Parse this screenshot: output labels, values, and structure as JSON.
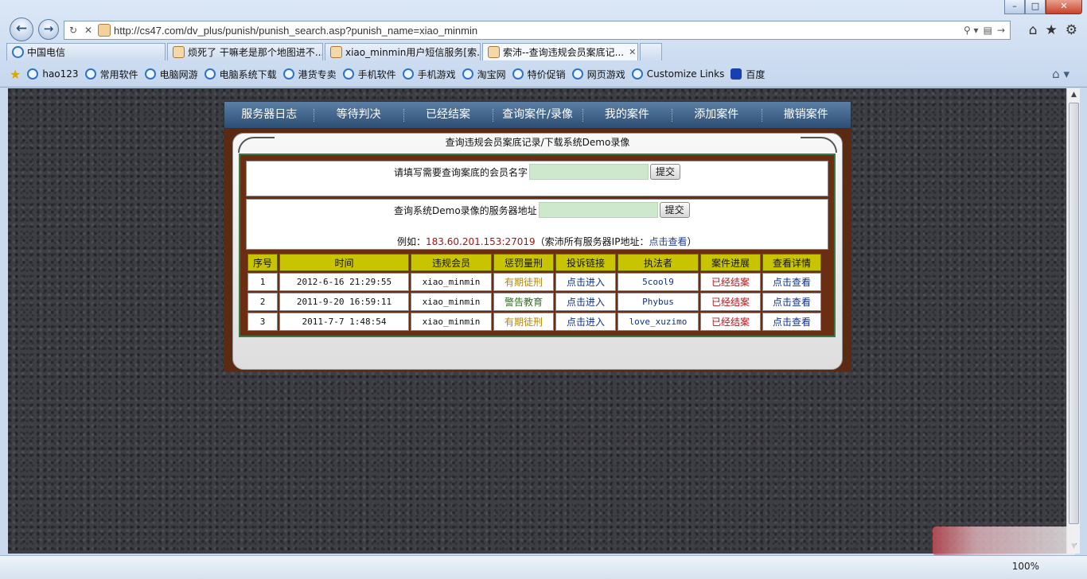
{
  "browser": {
    "url": "http://cs47.com/dv_plus/punish/punish_search.asp?punish_name=xiao_minmin",
    "tabs": [
      {
        "label": "中国电信",
        "icon": "ie-icon"
      },
      {
        "label": "烦死了 干嘛老是那个地图进不...",
        "icon": "face-icon"
      },
      {
        "label": "xiao_minmin用户短信服务[索...",
        "icon": "face-icon"
      },
      {
        "label": "索沛--查询违规会员案底记...",
        "icon": "face-icon",
        "active": true
      }
    ],
    "favorites": [
      "hao123",
      "常用软件",
      "电脑网游",
      "电脑系统下载",
      "港货专卖",
      "手机软件",
      "手机游戏",
      "淘宝网",
      "特价促销",
      "网页游戏",
      "Customize Links",
      "百度"
    ],
    "zoom": "100%"
  },
  "menu": [
    "服务器日志",
    "等待判决",
    "已经结案",
    "查询案件/录像",
    "我的案件",
    "添加案件",
    "撤销案件"
  ],
  "panel": {
    "title": "查询违规会员案底记录/下载系统Demo录像",
    "member_label": "请填写需要查询案底的会员名字",
    "submit": "提交",
    "server_label": "查询系统Demo录像的服务器地址",
    "example_prefix": "例如：",
    "example_ip": "183.60.201.153:27019",
    "example_mid": "（索沛所有服务器IP地址：",
    "example_link": "点击查看",
    "example_suffix": "）"
  },
  "table": {
    "headers": [
      "序号",
      "时间",
      "违规会员",
      "惩罚量刑",
      "投诉链接",
      "执法者",
      "案件进展",
      "查看详情"
    ],
    "rows": [
      [
        "1",
        "2012-6-16 21:29:55",
        "xiao_minmin",
        "有期徒刑",
        "点击进入",
        "5cool9",
        "已经结案",
        "点击查看"
      ],
      [
        "2",
        "2011-9-20 16:59:11",
        "xiao_minmin",
        "警告教育",
        "点击进入",
        "Phybus",
        "已经结案",
        "点击查看"
      ],
      [
        "3",
        "2011-7-7 1:48:54",
        "xiao_minmin",
        "有期徒刑",
        "点击进入",
        "love_xuzimo",
        "已经结案",
        "点击查看"
      ]
    ]
  }
}
